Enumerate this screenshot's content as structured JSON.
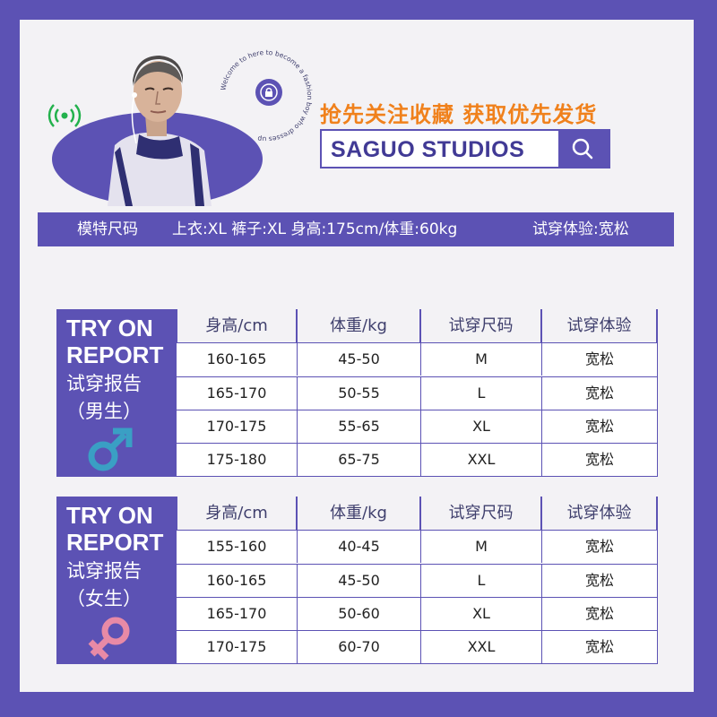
{
  "header": {
    "ring_text": "Welcome to here to become a fashion boy who dresses up",
    "promo_text": "抢先关注收藏  获取优先发货",
    "brand_name": "SAGUO STUDIOS",
    "model_label": "模特尺码",
    "model_info": "上衣:XL 裤子:XL 身高:175cm/体重:60kg",
    "try_on": "试穿体验:宽松"
  },
  "male_table": {
    "title_line1": "TRY ON",
    "title_line2": "REPORT",
    "title_cn": "试穿报告",
    "gender_cn": "（男生）",
    "symbol_color": "#3a9fc4",
    "headers": [
      "身高/cm",
      "体重/kg",
      "试穿尺码",
      "试穿体验"
    ],
    "rows": [
      [
        "160-165",
        "45-50",
        "M",
        "宽松"
      ],
      [
        "165-170",
        "50-55",
        "L",
        "宽松"
      ],
      [
        "170-175",
        "55-65",
        "XL",
        "宽松"
      ],
      [
        "175-180",
        "65-75",
        "XXL",
        "宽松"
      ]
    ]
  },
  "female_table": {
    "title_line1": "TRY ON",
    "title_line2": "REPORT",
    "title_cn": "试穿报告",
    "gender_cn": "（女生）",
    "symbol_color": "#e88aa6",
    "headers": [
      "身高/cm",
      "体重/kg",
      "试穿尺码",
      "试穿体验"
    ],
    "rows": [
      [
        "155-160",
        "40-45",
        "M",
        "宽松"
      ],
      [
        "160-165",
        "45-50",
        "L",
        "宽松"
      ],
      [
        "165-170",
        "50-60",
        "XL",
        "宽松"
      ],
      [
        "170-175",
        "60-70",
        "XXL",
        "宽松"
      ]
    ]
  },
  "colors": {
    "frame": "#5c52b4",
    "promo": "#f0811c",
    "brand_text": "#413a95",
    "wifi_icon": "#22b14c"
  }
}
